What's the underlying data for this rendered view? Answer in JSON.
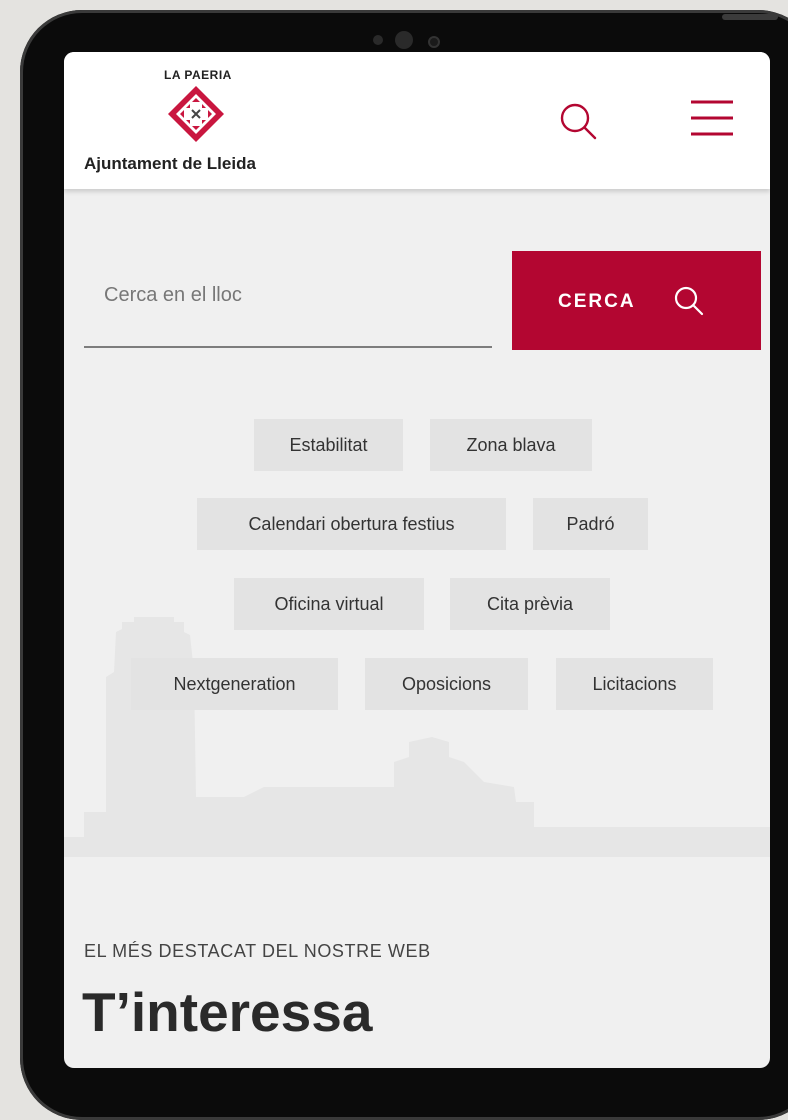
{
  "header": {
    "logo_top": "LA PAERIA",
    "logo_bottom": "Ajuntament de Lleida"
  },
  "search": {
    "placeholder": "Cerca en el lloc",
    "button_label": "CERCA"
  },
  "quick_links": [
    "Estabilitat",
    "Zona blava",
    "Calendari obertura festius",
    "Padró",
    "Oficina virtual",
    "Cita prèvia",
    "Nextgeneration",
    "Oposicions",
    "Licitacions"
  ],
  "featured": {
    "kicker": "EL MÉS DESTACAT DEL NOSTRE WEB",
    "title": "T’interessa"
  },
  "colors": {
    "brand": "#b30631",
    "background": "#f0f0f0",
    "chip": "#e3e3e3"
  }
}
